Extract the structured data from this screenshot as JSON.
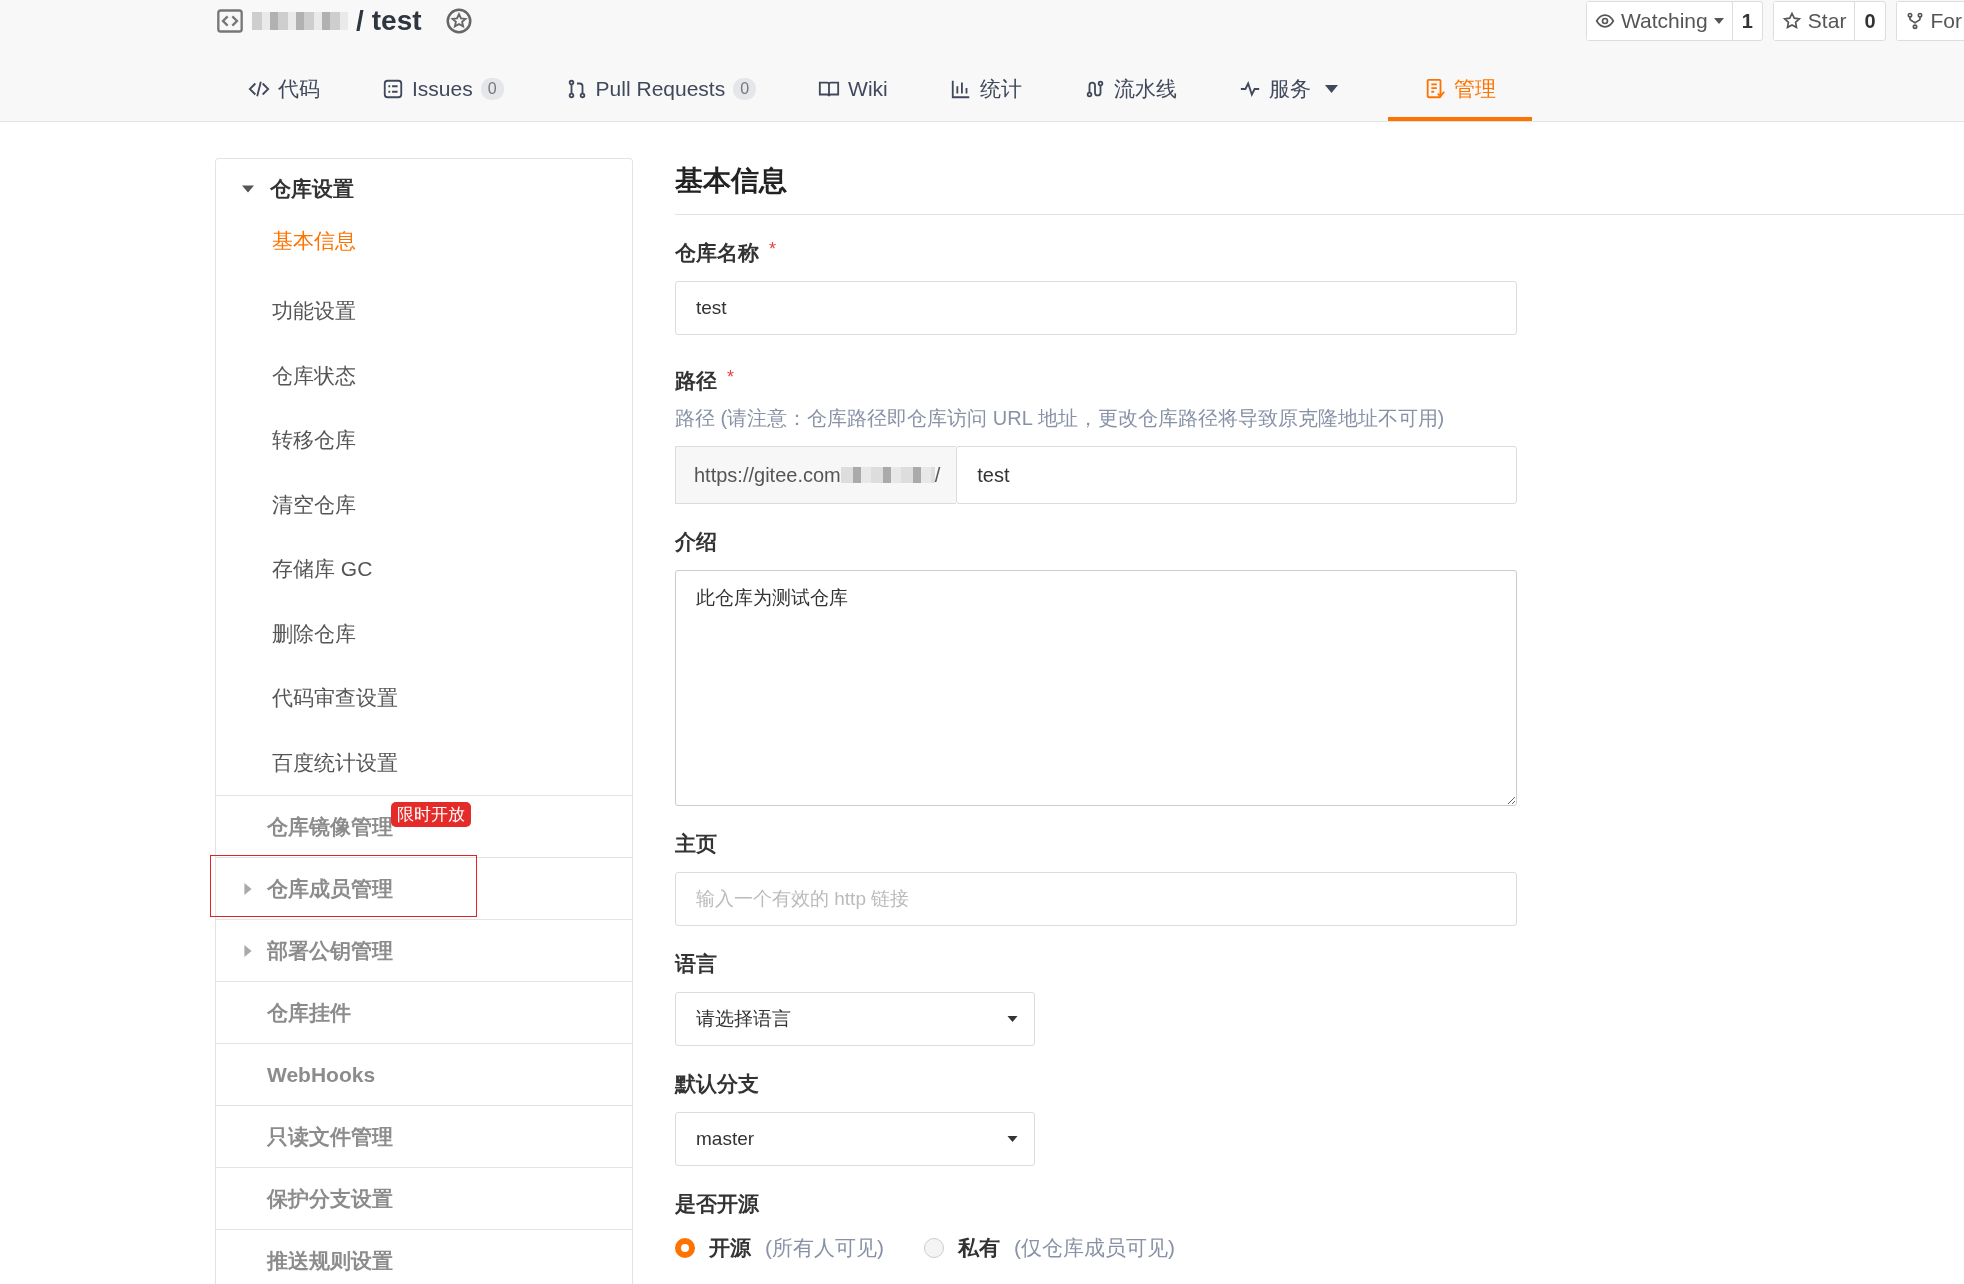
{
  "repo": {
    "separator": "/",
    "name": "test"
  },
  "actions": [
    {
      "kind": "watch",
      "label": "Watching",
      "count": "1"
    },
    {
      "kind": "star",
      "label": "Star",
      "count": "0"
    },
    {
      "kind": "fork",
      "label": "For"
    }
  ],
  "tabs": [
    {
      "kind": "code",
      "label": "代码",
      "selected": false
    },
    {
      "kind": "issues",
      "label": "Issues",
      "count": "0",
      "selected": false
    },
    {
      "kind": "pr",
      "label": "Pull Requests",
      "count": "0",
      "selected": false
    },
    {
      "kind": "wiki",
      "label": "Wiki",
      "selected": false
    },
    {
      "kind": "stats",
      "label": "统计",
      "selected": false
    },
    {
      "kind": "pipeline",
      "label": "流水线",
      "selected": false
    },
    {
      "kind": "services",
      "label": "服务",
      "dropdown": true,
      "selected": false
    },
    {
      "kind": "manage",
      "label": "管理",
      "selected": true
    }
  ],
  "sidebar": {
    "group": {
      "label": "仓库设置",
      "expanded": true,
      "items": [
        {
          "label": "基本信息",
          "selected": true
        },
        {
          "label": "功能设置",
          "selected": false
        },
        {
          "label": "仓库状态",
          "selected": false
        },
        {
          "label": "转移仓库",
          "selected": false
        },
        {
          "label": "清空仓库",
          "selected": false
        },
        {
          "label": "存储库 GC",
          "selected": false
        },
        {
          "label": "删除仓库",
          "selected": false
        },
        {
          "label": "代码审查设置",
          "selected": false
        },
        {
          "label": "百度统计设置",
          "selected": false
        }
      ]
    },
    "sections": [
      {
        "label": "仓库镜像管理",
        "badge": "限时开放",
        "highlighted": false
      },
      {
        "label": "仓库成员管理",
        "expandable": true,
        "highlighted": true
      },
      {
        "label": "部署公钥管理",
        "expandable": true,
        "highlighted": false
      },
      {
        "label": "仓库挂件",
        "highlighted": false
      },
      {
        "label": "WebHooks",
        "highlighted": false
      },
      {
        "label": "只读文件管理",
        "highlighted": false
      },
      {
        "label": "保护分支设置",
        "highlighted": false
      },
      {
        "label": "推送规则设置",
        "highlighted": false
      }
    ]
  },
  "form": {
    "title": "基本信息",
    "name": {
      "label": "仓库名称",
      "required": "*",
      "value": "test"
    },
    "path": {
      "label": "路径",
      "required": "*",
      "hint": "路径 (请注意：仓库路径即仓库访问 URL 地址，更改仓库路径将导致原克隆地址不可用)",
      "prefix": "https://gitee.com",
      "prefix_end": "/",
      "value": "test"
    },
    "description": {
      "label": "介绍",
      "value": "此仓库为测试仓库"
    },
    "homepage": {
      "label": "主页",
      "placeholder": "输入一个有效的 http 链接"
    },
    "language": {
      "label": "语言",
      "value": "请选择语言"
    },
    "branch": {
      "label": "默认分支",
      "value": "master"
    },
    "visibility": {
      "label": "是否开源",
      "options": [
        {
          "label": "开源",
          "note": "(所有人可见)",
          "selected": true
        },
        {
          "label": "私有",
          "note": "(仅仓库成员可见)",
          "selected": false
        }
      ]
    }
  }
}
